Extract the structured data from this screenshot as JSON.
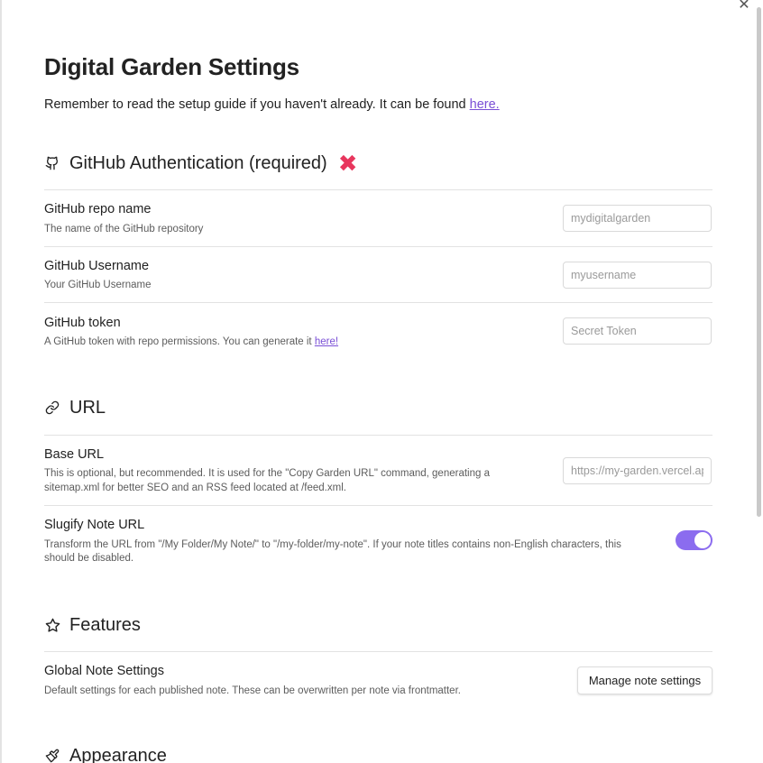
{
  "window": {
    "close_glyph": "✕"
  },
  "page": {
    "title": "Digital Garden Settings",
    "intro_text": "Remember to read the setup guide if you haven't already. It can be found ",
    "intro_link": "here."
  },
  "github": {
    "icon": "github-icon",
    "title": "GitHub Authentication (required)",
    "status_glyph": "✖",
    "status_color": "#e8365d",
    "repo": {
      "name": "GitHub repo name",
      "desc": "The name of the GitHub repository",
      "placeholder": "mydigitalgarden",
      "value": ""
    },
    "username": {
      "name": "GitHub Username",
      "desc": "Your GitHub Username",
      "placeholder": "myusername",
      "value": ""
    },
    "token": {
      "name": "GitHub token",
      "desc": "A GitHub token with repo permissions. You can generate it ",
      "link": "here!",
      "placeholder": "Secret Token",
      "value": ""
    }
  },
  "url": {
    "icon": "link-icon",
    "title": "URL",
    "base": {
      "name": "Base URL",
      "desc_line1": "This is optional, but recommended. It is used for the \"Copy Garden URL\" command, generating a",
      "desc_line2": "sitemap.xml for better SEO and an RSS feed located at /feed.xml.",
      "placeholder": "https://my-garden.vercel.app",
      "value": ""
    },
    "slugify": {
      "name": "Slugify Note URL",
      "desc_line1": "Transform the URL from \"/My Folder/My Note/\" to \"/my-folder/my-note\". If your note titles contains non-English characters, this",
      "desc_line2": "should be disabled.",
      "enabled": true,
      "accent": "#8b6cef"
    }
  },
  "features": {
    "icon": "star-icon",
    "title": "Features",
    "global": {
      "name": "Global Note Settings",
      "desc": "Default settings for each published note. These can be overwritten per note via frontmatter.",
      "button": "Manage note settings"
    }
  },
  "appearance": {
    "icon": "brush-icon",
    "title": "Appearance"
  }
}
